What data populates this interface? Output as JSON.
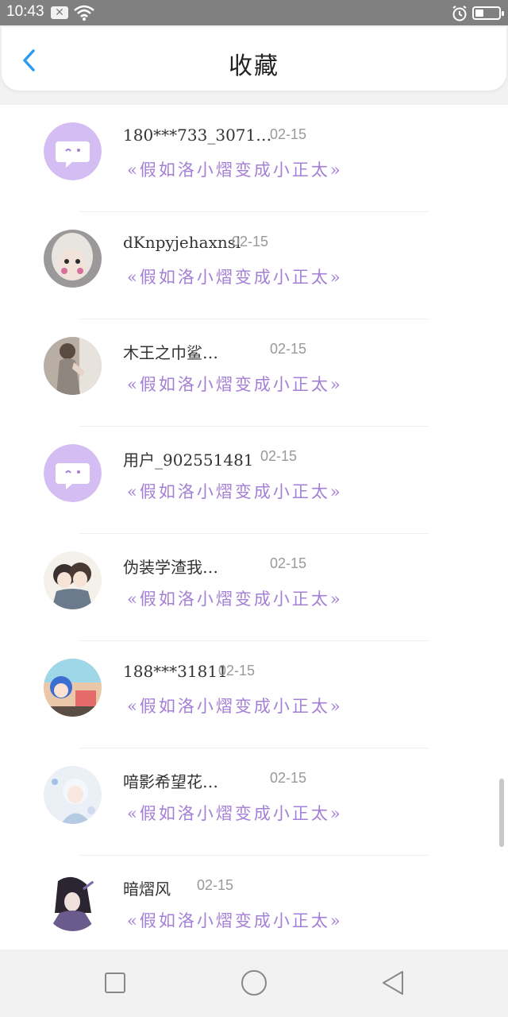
{
  "status_bar": {
    "time": "10:43",
    "x_label": "✕",
    "battery_level": 0.3
  },
  "header": {
    "title": "收藏"
  },
  "favorites": [
    {
      "username": "180***733_3071…",
      "date": "02-15",
      "title": "«假如洛小熠变成小正太»",
      "avatar": "speech-bubble-avatar"
    },
    {
      "username": "dKnpyjehaxnsl",
      "date": "02-15",
      "title": "«假如洛小熠变成小正太»",
      "avatar": "doll-photo-avatar"
    },
    {
      "username": "木王之巾鲨…",
      "date": "02-15",
      "title": "«假如洛小熠变成小正太»",
      "avatar": "person-photo-avatar"
    },
    {
      "username": "用户_902551481",
      "date": "02-15",
      "title": "«假如洛小熠变成小正太»",
      "avatar": "speech-bubble-avatar"
    },
    {
      "username": "伪装学渣我…",
      "date": "02-15",
      "title": "«假如洛小熠变成小正太»",
      "avatar": "anime-couple-avatar"
    },
    {
      "username": "188***31811",
      "date": "02-15",
      "title": "«假如洛小熠变成小正太»",
      "avatar": "anime-character-avatar"
    },
    {
      "username": "喑影希望花…",
      "date": "02-15",
      "title": "«假如洛小熠变成小正太»",
      "avatar": "anime-girl-avatar"
    },
    {
      "username": "暗熠风",
      "date": "02-15",
      "title": "«假如洛小熠变成小正太»",
      "avatar": "anime-warrior-avatar"
    }
  ],
  "colors": {
    "accent": "#a47fd6",
    "back_arrow": "#2e9cf0",
    "avatar_bubble_bg": "#d3bdf2"
  }
}
